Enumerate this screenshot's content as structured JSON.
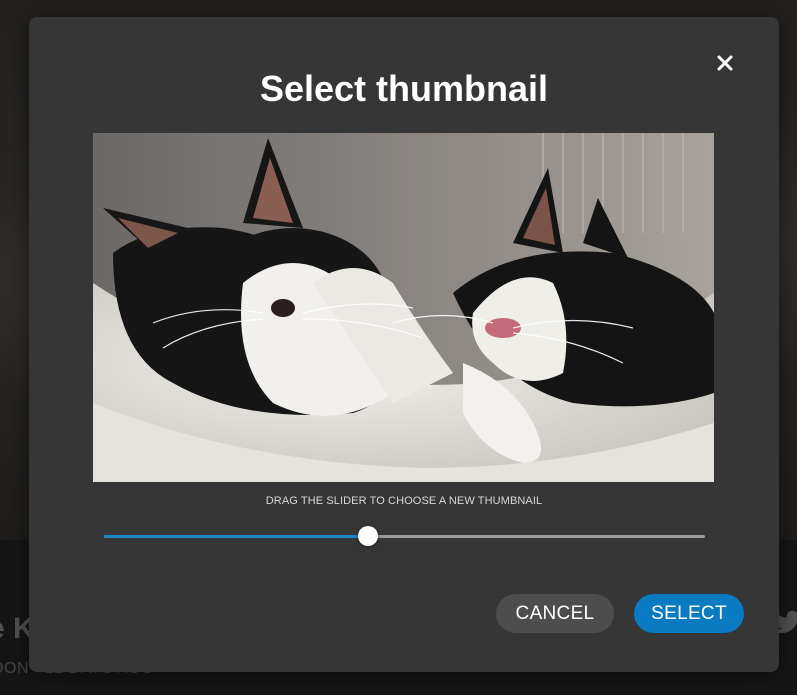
{
  "background_page": {
    "title_fragment": "e Ki",
    "meta_fragment": "DON · 12 DAYS AGO",
    "share_icon": "twitter-icon"
  },
  "modal": {
    "title": "Select thumbnail",
    "close_icon": "close-icon",
    "thumbnail_alt": "two black and white kittens in a fleece hammock",
    "hint": "DRAG THE SLIDER TO CHOOSE A NEW THUMBNAIL",
    "slider": {
      "value_fraction": 0.44
    },
    "buttons": {
      "cancel_label": "CANCEL",
      "select_label": "SELECT"
    }
  },
  "colors": {
    "modal_bg": "#363636",
    "accent": "#0a7bc3",
    "slider_fill": "#1f86c8",
    "cancel_bg": "#4d4d4d"
  }
}
